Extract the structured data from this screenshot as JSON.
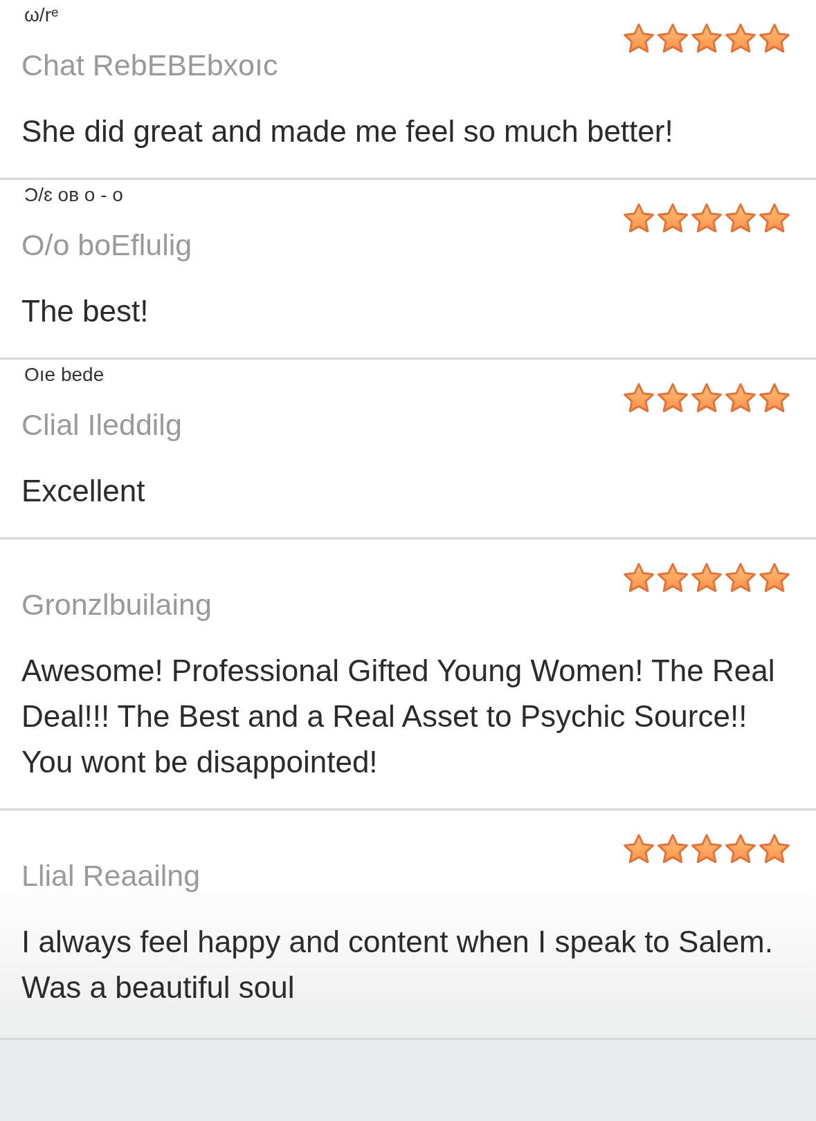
{
  "reviews": [
    {
      "subtitle": "ω/rᵉ",
      "title": "Chat RebEBEbxoıc",
      "stars": 5,
      "text": "She did great and made me feel so much better!"
    },
    {
      "subtitle": "Ͻ/ɛ oв o - o",
      "title": "O/o boEflulig",
      "stars": 5,
      "text": "The best!"
    },
    {
      "subtitle": "Oıe bede",
      "title": "Clial Ileddilg",
      "stars": 5,
      "text": "Excellent"
    },
    {
      "title": "Gronzlbuilaing",
      "stars": 5,
      "text": "Awesome! Professional Gifted Young Women! The Real Deal!!! The Best and a Real Asset to Psychic Source!! You wont be disappointed!"
    },
    {
      "title": "Llial Reaailng",
      "stars": 5,
      "text": "I always feel happy and content when I speak to Salem. Was a beautiful soul"
    }
  ]
}
